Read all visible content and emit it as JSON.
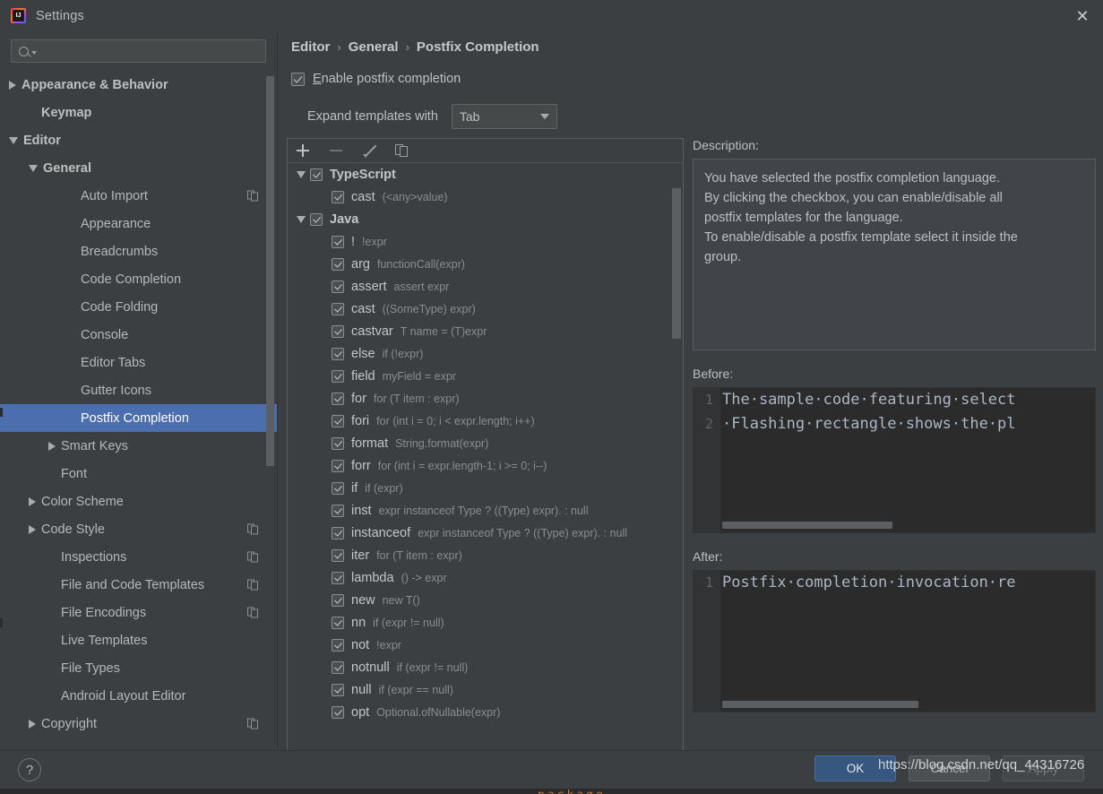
{
  "window": {
    "title": "Settings",
    "app_icon": "intellij-idea-icon",
    "close_label": "✕"
  },
  "sidebar": {
    "search": {
      "value": "",
      "placeholder": ""
    },
    "items": [
      {
        "label": "Appearance & Behavior",
        "indent": 0,
        "twisty": "collapsed",
        "bold": true,
        "selected": false,
        "badge": false
      },
      {
        "label": "Keymap",
        "indent": 1,
        "twisty": "none",
        "bold": true,
        "selected": false,
        "badge": false
      },
      {
        "label": "Editor",
        "indent": 0,
        "twisty": "expanded",
        "bold": true,
        "selected": false,
        "badge": false
      },
      {
        "label": "General",
        "indent": 1,
        "twisty": "expanded",
        "bold": true,
        "selected": false,
        "badge": false
      },
      {
        "label": "Auto Import",
        "indent": 3,
        "twisty": "none",
        "bold": false,
        "selected": false,
        "badge": true
      },
      {
        "label": "Appearance",
        "indent": 3,
        "twisty": "none",
        "bold": false,
        "selected": false,
        "badge": false
      },
      {
        "label": "Breadcrumbs",
        "indent": 3,
        "twisty": "none",
        "bold": false,
        "selected": false,
        "badge": false
      },
      {
        "label": "Code Completion",
        "indent": 3,
        "twisty": "none",
        "bold": false,
        "selected": false,
        "badge": false
      },
      {
        "label": "Code Folding",
        "indent": 3,
        "twisty": "none",
        "bold": false,
        "selected": false,
        "badge": false
      },
      {
        "label": "Console",
        "indent": 3,
        "twisty": "none",
        "bold": false,
        "selected": false,
        "badge": false
      },
      {
        "label": "Editor Tabs",
        "indent": 3,
        "twisty": "none",
        "bold": false,
        "selected": false,
        "badge": false
      },
      {
        "label": "Gutter Icons",
        "indent": 3,
        "twisty": "none",
        "bold": false,
        "selected": false,
        "badge": false
      },
      {
        "label": "Postfix Completion",
        "indent": 3,
        "twisty": "none",
        "bold": false,
        "selected": true,
        "badge": false
      },
      {
        "label": "Smart Keys",
        "indent": 2,
        "twisty": "collapsed",
        "bold": false,
        "selected": false,
        "badge": false
      },
      {
        "label": "Font",
        "indent": 2,
        "twisty": "none",
        "bold": false,
        "selected": false,
        "badge": false
      },
      {
        "label": "Color Scheme",
        "indent": 1,
        "twisty": "collapsed",
        "bold": false,
        "selected": false,
        "badge": false
      },
      {
        "label": "Code Style",
        "indent": 1,
        "twisty": "collapsed",
        "bold": false,
        "selected": false,
        "badge": true
      },
      {
        "label": "Inspections",
        "indent": 2,
        "twisty": "none",
        "bold": false,
        "selected": false,
        "badge": true
      },
      {
        "label": "File and Code Templates",
        "indent": 2,
        "twisty": "none",
        "bold": false,
        "selected": false,
        "badge": true
      },
      {
        "label": "File Encodings",
        "indent": 2,
        "twisty": "none",
        "bold": false,
        "selected": false,
        "badge": true
      },
      {
        "label": "Live Templates",
        "indent": 2,
        "twisty": "none",
        "bold": false,
        "selected": false,
        "badge": false
      },
      {
        "label": "File Types",
        "indent": 2,
        "twisty": "none",
        "bold": false,
        "selected": false,
        "badge": false
      },
      {
        "label": "Android Layout Editor",
        "indent": 2,
        "twisty": "none",
        "bold": false,
        "selected": false,
        "badge": false
      },
      {
        "label": "Copyright",
        "indent": 1,
        "twisty": "collapsed",
        "bold": false,
        "selected": false,
        "badge": true
      }
    ]
  },
  "main": {
    "breadcrumb": [
      "Editor",
      "General",
      "Postfix Completion"
    ],
    "breadcrumb_separator": "›",
    "enable_checkbox": {
      "label_prefix": "",
      "label_mnemonic": "E",
      "label_rest": "nable postfix completion",
      "checked": true
    },
    "expand_templates": {
      "label": "Expand templates with",
      "value": "Tab"
    },
    "toolbar": {
      "add_label": "add-template",
      "remove_label": "remove-template",
      "edit_label": "edit-template",
      "copy_label": "duplicate-template"
    },
    "templates": [
      {
        "indent": 0,
        "twisty": "expanded",
        "group": true,
        "key": "TypeScript",
        "desc": ""
      },
      {
        "indent": 1,
        "twisty": "none",
        "group": false,
        "key": "cast",
        "desc": "(<any>value)"
      },
      {
        "indent": 0,
        "twisty": "expanded",
        "group": true,
        "key": "Java",
        "desc": ""
      },
      {
        "indent": 1,
        "twisty": "none",
        "group": false,
        "key": "!",
        "desc": "!expr"
      },
      {
        "indent": 1,
        "twisty": "none",
        "group": false,
        "key": "arg",
        "desc": "functionCall(expr)"
      },
      {
        "indent": 1,
        "twisty": "none",
        "group": false,
        "key": "assert",
        "desc": "assert expr"
      },
      {
        "indent": 1,
        "twisty": "none",
        "group": false,
        "key": "cast",
        "desc": "((SomeType) expr)"
      },
      {
        "indent": 1,
        "twisty": "none",
        "group": false,
        "key": "castvar",
        "desc": "T name = (T)expr"
      },
      {
        "indent": 1,
        "twisty": "none",
        "group": false,
        "key": "else",
        "desc": "if (!expr)"
      },
      {
        "indent": 1,
        "twisty": "none",
        "group": false,
        "key": "field",
        "desc": "myField = expr"
      },
      {
        "indent": 1,
        "twisty": "none",
        "group": false,
        "key": "for",
        "desc": "for (T item : expr)"
      },
      {
        "indent": 1,
        "twisty": "none",
        "group": false,
        "key": "fori",
        "desc": "for (int i = 0; i < expr.length; i++)"
      },
      {
        "indent": 1,
        "twisty": "none",
        "group": false,
        "key": "format",
        "desc": "String.format(expr)"
      },
      {
        "indent": 1,
        "twisty": "none",
        "group": false,
        "key": "forr",
        "desc": "for (int i = expr.length-1; i >= 0; i--)"
      },
      {
        "indent": 1,
        "twisty": "none",
        "group": false,
        "key": "if",
        "desc": "if (expr)"
      },
      {
        "indent": 1,
        "twisty": "none",
        "group": false,
        "key": "inst",
        "desc": "expr instanceof Type ? ((Type) expr). : null"
      },
      {
        "indent": 1,
        "twisty": "none",
        "group": false,
        "key": "instanceof",
        "desc": "expr instanceof Type ? ((Type) expr). : null"
      },
      {
        "indent": 1,
        "twisty": "none",
        "group": false,
        "key": "iter",
        "desc": "for (T item : expr)"
      },
      {
        "indent": 1,
        "twisty": "none",
        "group": false,
        "key": "lambda",
        "desc": "() -> expr"
      },
      {
        "indent": 1,
        "twisty": "none",
        "group": false,
        "key": "new",
        "desc": "new T()"
      },
      {
        "indent": 1,
        "twisty": "none",
        "group": false,
        "key": "nn",
        "desc": "if (expr != null)"
      },
      {
        "indent": 1,
        "twisty": "none",
        "group": false,
        "key": "not",
        "desc": "!expr"
      },
      {
        "indent": 1,
        "twisty": "none",
        "group": false,
        "key": "notnull",
        "desc": "if (expr != null)"
      },
      {
        "indent": 1,
        "twisty": "none",
        "group": false,
        "key": "null",
        "desc": "if (expr == null)"
      },
      {
        "indent": 1,
        "twisty": "none",
        "group": false,
        "key": "opt",
        "desc": "Optional.ofNullable(expr)"
      }
    ],
    "description": {
      "label": "Description:",
      "lines": [
        "You have selected the postfix completion language.",
        "By clicking the checkbox, you can enable/disable all",
        "postfix templates for the language.",
        "To enable/disable a postfix template select it inside the",
        "group."
      ]
    },
    "before": {
      "label": "Before:",
      "lines": [
        {
          "num": "1",
          "text": "The·sample·code·featuring·select"
        },
        {
          "num": "2",
          "text": "·Flashing·rectangle·shows·the·pl"
        }
      ]
    },
    "after": {
      "label": "After:",
      "lines": [
        {
          "num": "1",
          "text": "Postfix·completion·invocation·re"
        }
      ]
    }
  },
  "footer": {
    "help_label": "?",
    "ok_label": "OK",
    "cancel_label": "Cancel",
    "apply_label": "Apply",
    "watermark": "https://blog.csdn.net/qq_44316726"
  },
  "colors": {
    "dialog_bg": "#3c3f41",
    "selection_blue": "#4b6eaf",
    "ok_button": "#365880",
    "editor_bg": "#2b2b2b",
    "code_text": "#a9b7c6"
  }
}
